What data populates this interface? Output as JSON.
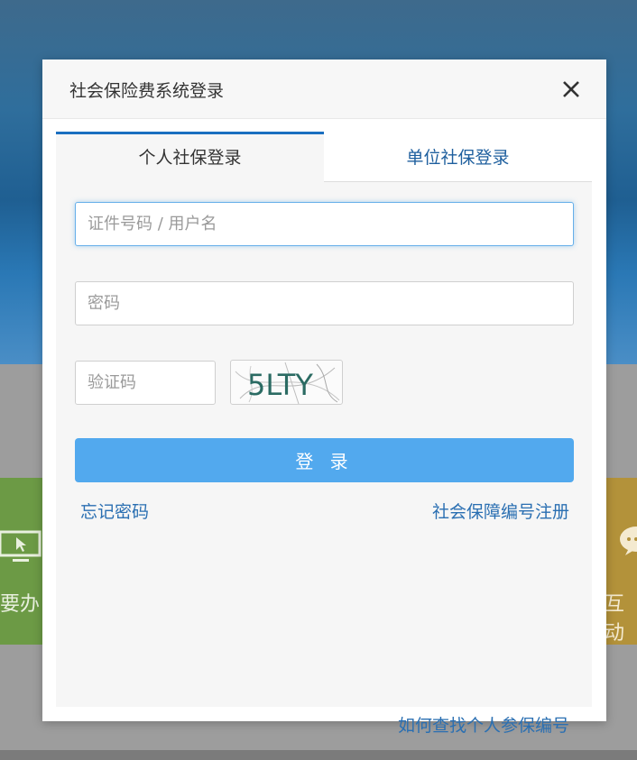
{
  "modal": {
    "title": "社会保险费系统登录",
    "close_icon": "close-icon"
  },
  "tabs": [
    {
      "label": "个人社保登录",
      "active": true
    },
    {
      "label": "单位社保登录",
      "active": false
    }
  ],
  "form": {
    "username_placeholder": "证件号码 / 用户名",
    "password_placeholder": "密码",
    "captcha_placeholder": "验证码",
    "captcha_text": "5LTY",
    "login_label": "登 录"
  },
  "links": {
    "forgot_password": "忘记密码",
    "register": "社会保障编号注册",
    "lookup": "如何查找个人参保编号"
  },
  "background": {
    "left_card_text": "要办",
    "right_card_text": "互动"
  },
  "colors": {
    "accent": "#52a9ee",
    "tab_active_border": "#1a6fc0",
    "link": "#2a6fb2"
  }
}
